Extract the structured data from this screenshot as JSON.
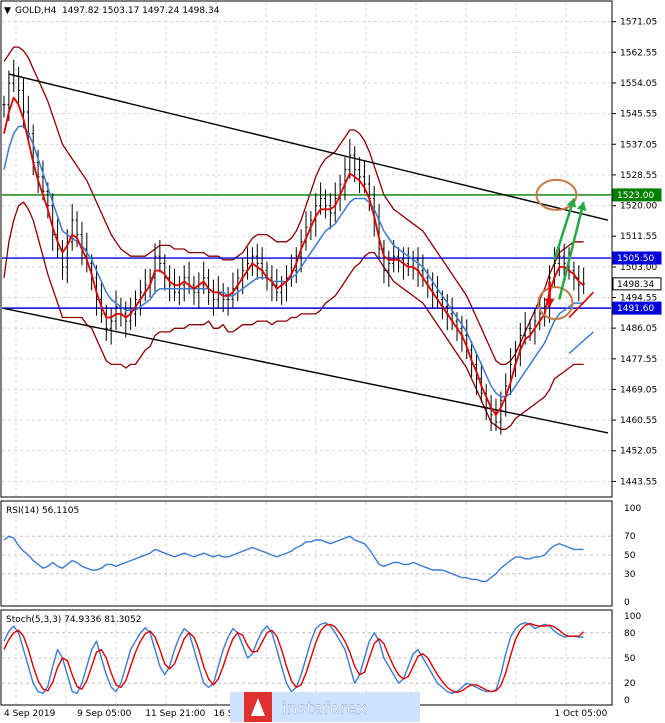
{
  "header": {
    "symbol": "GOLD,H4",
    "ohlc": "1497.82 1503.17 1497.24 1498.34",
    "arrow_glyph": "▼"
  },
  "watermark": {
    "text": "instaforex"
  },
  "colors": {
    "price_line": "#000000",
    "red_ma": "#e00000",
    "blue_ma": "#3a7bd5",
    "bollinger": "#8b0000",
    "h_green": "#008000",
    "h_blue": "#0000dd",
    "circle": "#c87a4a",
    "green_arrow": "#22aa44",
    "red_arrow": "#e00000",
    "rsi_line": "#3a7bd5",
    "stoch_main": "#3a7bd5",
    "stoch_signal": "#e00000",
    "banner_bg": "#cfe3ff",
    "watermark_bg": "#e03030",
    "watermark_fg": "#ffffff"
  },
  "chart_data": [
    {
      "type": "line",
      "panel": "price",
      "ylim": [
        1439.5,
        1576.5
      ],
      "y_ticks": [
        "1571.05",
        "1562.55",
        "1554.05",
        "1545.55",
        "1537.05",
        "1528.55",
        "1520.00",
        "1511.55",
        "1503.00",
        "1494.55",
        "1486.05",
        "1477.55",
        "1469.05",
        "1460.55",
        "1452.05",
        "1443.55"
      ],
      "y_tick_values": [
        1571.05,
        1562.55,
        1554.05,
        1545.55,
        1537.05,
        1528.55,
        1520.0,
        1511.55,
        1503.0,
        1494.55,
        1486.05,
        1477.55,
        1469.05,
        1460.55,
        1452.05,
        1443.55
      ],
      "x_ticks": [
        "4 Sep 2019",
        "9 Sep 05:00",
        "11 Sep 21:00",
        "16 Sep 13:00",
        "",
        "",
        "",
        "",
        "1 Oct 05:00"
      ],
      "x_tick_index": [
        0,
        15,
        29,
        43,
        57,
        71,
        85,
        99,
        113
      ],
      "n_bars": 125,
      "price_labels": [
        {
          "value": 1523.0,
          "label": "1523.00",
          "color": "green"
        },
        {
          "value": 1505.5,
          "label": "1505.50",
          "color": "blue"
        },
        {
          "value": 1498.34,
          "label": "1498.34",
          "color": "black"
        },
        {
          "value": 1491.6,
          "label": "1491.60",
          "color": "blue"
        }
      ],
      "close_series": [
        1548,
        1554,
        1556,
        1552,
        1546,
        1540,
        1532,
        1528,
        1524,
        1520,
        1512,
        1508,
        1503,
        1510,
        1516,
        1512,
        1508,
        1504,
        1500,
        1494,
        1490,
        1486,
        1488,
        1492,
        1490,
        1488,
        1490,
        1494,
        1496,
        1498,
        1500,
        1506,
        1504,
        1500,
        1498,
        1496,
        1498,
        1500,
        1498,
        1496,
        1498,
        1500,
        1496,
        1494,
        1496,
        1494,
        1494,
        1497,
        1500,
        1502,
        1504,
        1506,
        1504,
        1502,
        1500,
        1498,
        1496,
        1498,
        1500,
        1502,
        1506,
        1510,
        1514,
        1516,
        1520,
        1522,
        1520,
        1518,
        1522,
        1526,
        1530,
        1534,
        1530,
        1528,
        1526,
        1522,
        1516,
        1508,
        1502,
        1504,
        1506,
        1505,
        1504,
        1503,
        1505,
        1502,
        1500,
        1498,
        1496,
        1494,
        1492,
        1490,
        1488,
        1486,
        1484,
        1480,
        1476,
        1472,
        1468,
        1464,
        1462,
        1460,
        1466,
        1470,
        1476,
        1480,
        1484,
        1486,
        1486,
        1488,
        1490,
        1492,
        1500,
        1504,
        1506,
        1504,
        1502,
        1500,
        1498,
        1498.34
      ],
      "red_ma": [
        1540,
        1546,
        1550,
        1548,
        1544,
        1538,
        1532,
        1527,
        1523,
        1519,
        1514,
        1510,
        1507,
        1509,
        1512,
        1511,
        1508,
        1505,
        1501,
        1496,
        1492,
        1489,
        1489,
        1490,
        1490,
        1489,
        1490,
        1492,
        1494,
        1496,
        1498,
        1502,
        1502,
        1501,
        1499,
        1498,
        1498,
        1499,
        1498,
        1497,
        1498,
        1499,
        1497,
        1496,
        1496,
        1495,
        1495,
        1496,
        1498,
        1500,
        1502,
        1504,
        1503,
        1502,
        1500,
        1499,
        1497,
        1498,
        1499,
        1501,
        1504,
        1508,
        1511,
        1514,
        1517,
        1519,
        1519,
        1519,
        1520,
        1523,
        1526,
        1529,
        1528,
        1527,
        1525,
        1522,
        1517,
        1511,
        1506,
        1505,
        1505,
        1505,
        1504,
        1503,
        1503,
        1502,
        1500,
        1498,
        1496,
        1494,
        1492,
        1490,
        1488,
        1486,
        1484,
        1481,
        1477,
        1474,
        1470,
        1467,
        1464,
        1462,
        1464,
        1467,
        1471,
        1476,
        1480,
        1483,
        1484,
        1486,
        1488,
        1490,
        1496,
        1500,
        1503,
        1503,
        1502,
        1501,
        1499,
        1498
      ],
      "blue_ma": [
        1530,
        1536,
        1540,
        1542,
        1542,
        1540,
        1537,
        1533,
        1529,
        1525,
        1521,
        1517,
        1513,
        1512,
        1511,
        1510,
        1509,
        1507,
        1505,
        1502,
        1499,
        1496,
        1494,
        1493,
        1492,
        1491,
        1491,
        1491,
        1492,
        1493,
        1494,
        1496,
        1497,
        1497,
        1497,
        1497,
        1497,
        1497,
        1497,
        1497,
        1497,
        1497,
        1497,
        1496,
        1496,
        1496,
        1495,
        1495,
        1496,
        1497,
        1498,
        1499,
        1500,
        1500,
        1500,
        1499,
        1499,
        1499,
        1499,
        1500,
        1501,
        1503,
        1505,
        1507,
        1509,
        1511,
        1513,
        1514,
        1515,
        1517,
        1519,
        1521,
        1522,
        1522,
        1522,
        1521,
        1519,
        1516,
        1513,
        1511,
        1509,
        1508,
        1507,
        1506,
        1505,
        1504,
        1503,
        1501,
        1499,
        1497,
        1495,
        1493,
        1491,
        1489,
        1487,
        1485,
        1482,
        1479,
        1476,
        1473,
        1470,
        1468,
        1467,
        1467,
        1468,
        1470,
        1472,
        1474,
        1476,
        1478,
        1480,
        1482,
        1485,
        1488,
        1490,
        1491,
        1492,
        1493,
        1493,
        1493
      ],
      "boll_upper": [
        1560,
        1562,
        1564,
        1564,
        1563,
        1561,
        1558,
        1555,
        1552,
        1549,
        1545,
        1541,
        1537,
        1535,
        1533,
        1531,
        1529,
        1527,
        1524,
        1521,
        1518,
        1515,
        1512,
        1510,
        1508,
        1507,
        1506,
        1506,
        1506,
        1506,
        1507,
        1508,
        1509,
        1509,
        1509,
        1508,
        1508,
        1508,
        1507,
        1507,
        1507,
        1507,
        1506,
        1506,
        1506,
        1505,
        1505,
        1505,
        1506,
        1507,
        1509,
        1511,
        1512,
        1512,
        1512,
        1511,
        1510,
        1510,
        1510,
        1511,
        1513,
        1516,
        1520,
        1524,
        1528,
        1531,
        1533,
        1534,
        1535,
        1537,
        1539,
        1541,
        1541,
        1540,
        1538,
        1535,
        1531,
        1527,
        1523,
        1521,
        1519,
        1518,
        1517,
        1516,
        1515,
        1514,
        1513,
        1511,
        1509,
        1507,
        1505,
        1503,
        1501,
        1499,
        1497,
        1495,
        1492,
        1489,
        1486,
        1483,
        1480,
        1477,
        1476,
        1476,
        1477,
        1479,
        1482,
        1485,
        1488,
        1491,
        1494,
        1497,
        1501,
        1504,
        1507,
        1508,
        1509,
        1510,
        1510,
        1510
      ],
      "boll_lower": [
        1500,
        1510,
        1516,
        1520,
        1521,
        1519,
        1516,
        1511,
        1506,
        1501,
        1497,
        1493,
        1489,
        1489,
        1489,
        1489,
        1489,
        1487,
        1486,
        1483,
        1480,
        1477,
        1476,
        1476,
        1476,
        1475,
        1476,
        1476,
        1478,
        1480,
        1481,
        1484,
        1485,
        1485,
        1485,
        1486,
        1486,
        1486,
        1487,
        1487,
        1487,
        1487,
        1488,
        1486,
        1486,
        1487,
        1485,
        1485,
        1486,
        1487,
        1487,
        1487,
        1488,
        1488,
        1488,
        1487,
        1488,
        1488,
        1488,
        1489,
        1489,
        1490,
        1490,
        1490,
        1490,
        1491,
        1493,
        1494,
        1495,
        1497,
        1499,
        1501,
        1503,
        1504,
        1506,
        1507,
        1507,
        1505,
        1503,
        1501,
        1499,
        1498,
        1497,
        1496,
        1495,
        1494,
        1493,
        1491,
        1489,
        1487,
        1485,
        1483,
        1481,
        1479,
        1477,
        1475,
        1472,
        1469,
        1466,
        1463,
        1460,
        1459,
        1458,
        1458,
        1459,
        1461,
        1462,
        1463,
        1464,
        1465,
        1466,
        1467,
        1469,
        1472,
        1473,
        1474,
        1475,
        1476,
        1476,
        1476
      ]
    },
    {
      "type": "line",
      "panel": "rsi",
      "title": "RSI(14) 56.1105",
      "ylim": [
        0,
        100
      ],
      "y_ticks": [
        "100",
        "70",
        "50",
        "30",
        "0"
      ],
      "y_tick_values": [
        100,
        70,
        50,
        30,
        0
      ],
      "values": [
        66,
        70,
        68,
        60,
        54,
        50,
        44,
        40,
        36,
        38,
        42,
        38,
        36,
        40,
        44,
        42,
        38,
        36,
        34,
        34,
        36,
        40,
        40,
        38,
        40,
        42,
        44,
        46,
        48,
        50,
        52,
        56,
        54,
        52,
        50,
        48,
        50,
        52,
        50,
        48,
        50,
        52,
        50,
        48,
        50,
        48,
        48,
        50,
        52,
        54,
        56,
        58,
        56,
        54,
        52,
        50,
        48,
        50,
        52,
        54,
        58,
        60,
        64,
        64,
        66,
        66,
        64,
        62,
        64,
        66,
        68,
        70,
        66,
        64,
        62,
        56,
        48,
        40,
        38,
        40,
        42,
        42,
        40,
        40,
        42,
        40,
        38,
        36,
        34,
        34,
        34,
        32,
        30,
        28,
        26,
        26,
        24,
        24,
        22,
        22,
        26,
        30,
        36,
        40,
        44,
        48,
        48,
        46,
        46,
        48,
        48,
        50,
        56,
        60,
        62,
        60,
        58,
        56,
        56,
        56.11
      ]
    },
    {
      "type": "line",
      "panel": "stoch",
      "title": "Stoch(5,3,3) 74.9336 81.3052",
      "ylim": [
        0,
        100
      ],
      "y_ticks": [
        "100",
        "80",
        "50",
        "20",
        "0"
      ],
      "y_tick_values": [
        100,
        80,
        50,
        20,
        0
      ],
      "main": [
        70,
        82,
        88,
        80,
        60,
        40,
        20,
        10,
        8,
        16,
        40,
        60,
        50,
        30,
        10,
        8,
        20,
        40,
        60,
        70,
        50,
        30,
        15,
        10,
        20,
        40,
        60,
        70,
        80,
        86,
        80,
        60,
        40,
        30,
        40,
        60,
        75,
        85,
        80,
        60,
        40,
        20,
        15,
        20,
        40,
        60,
        75,
        85,
        80,
        65,
        50,
        55,
        70,
        82,
        88,
        80,
        60,
        40,
        20,
        10,
        15,
        30,
        50,
        70,
        85,
        90,
        92,
        88,
        80,
        70,
        60,
        40,
        20,
        30,
        50,
        70,
        80,
        70,
        50,
        40,
        30,
        20,
        25,
        40,
        55,
        60,
        50,
        40,
        30,
        20,
        15,
        10,
        8,
        10,
        15,
        20,
        18,
        15,
        12,
        10,
        10,
        12,
        30,
        55,
        75,
        85,
        90,
        92,
        90,
        85,
        88,
        90,
        88,
        82,
        78,
        75,
        76,
        76,
        75,
        74.93
      ],
      "signal": [
        60,
        72,
        80,
        83,
        76,
        60,
        40,
        23,
        13,
        11,
        21,
        39,
        50,
        47,
        30,
        16,
        13,
        23,
        40,
        57,
        60,
        50,
        32,
        18,
        15,
        23,
        40,
        57,
        70,
        79,
        82,
        75,
        60,
        43,
        37,
        43,
        58,
        73,
        80,
        75,
        60,
        40,
        25,
        18,
        25,
        40,
        58,
        73,
        80,
        77,
        65,
        57,
        58,
        69,
        80,
        83,
        76,
        60,
        40,
        23,
        15,
        18,
        32,
        50,
        68,
        82,
        89,
        90,
        87,
        79,
        70,
        57,
        40,
        30,
        33,
        50,
        67,
        73,
        67,
        53,
        40,
        30,
        25,
        28,
        40,
        52,
        55,
        50,
        40,
        30,
        22,
        15,
        11,
        9,
        11,
        15,
        18,
        18,
        15,
        12,
        10,
        11,
        17,
        32,
        53,
        72,
        83,
        89,
        91,
        89,
        88,
        88,
        89,
        87,
        83,
        78,
        76,
        76,
        76,
        81.31
      ]
    }
  ],
  "annotations": {
    "upper_channel": {
      "start": [
        1,
        1556.5
      ],
      "end": [
        124,
        1516
      ]
    },
    "lower_channel": {
      "start": [
        0,
        1491.5
      ],
      "end": [
        124,
        1457
      ]
    },
    "circle_upper": {
      "x": 113,
      "y": 1523
    },
    "circle_lower": {
      "x": 113,
      "y": 1493
    },
    "red_arrow": {
      "from": [
        112,
        1499
      ],
      "to": [
        112,
        1492
      ]
    },
    "green_arrow_1": {
      "from": [
        113,
        1505
      ],
      "to": [
        117,
        1522
      ]
    },
    "green_arrow_2": {
      "from": [
        114,
        1494
      ],
      "to": [
        119,
        1521
      ]
    },
    "tail_red": {
      "from": [
        116,
        1489
      ],
      "to": [
        121,
        1496
      ]
    },
    "tail_blue": {
      "from": [
        116,
        1479
      ],
      "to": [
        121,
        1485
      ]
    }
  }
}
